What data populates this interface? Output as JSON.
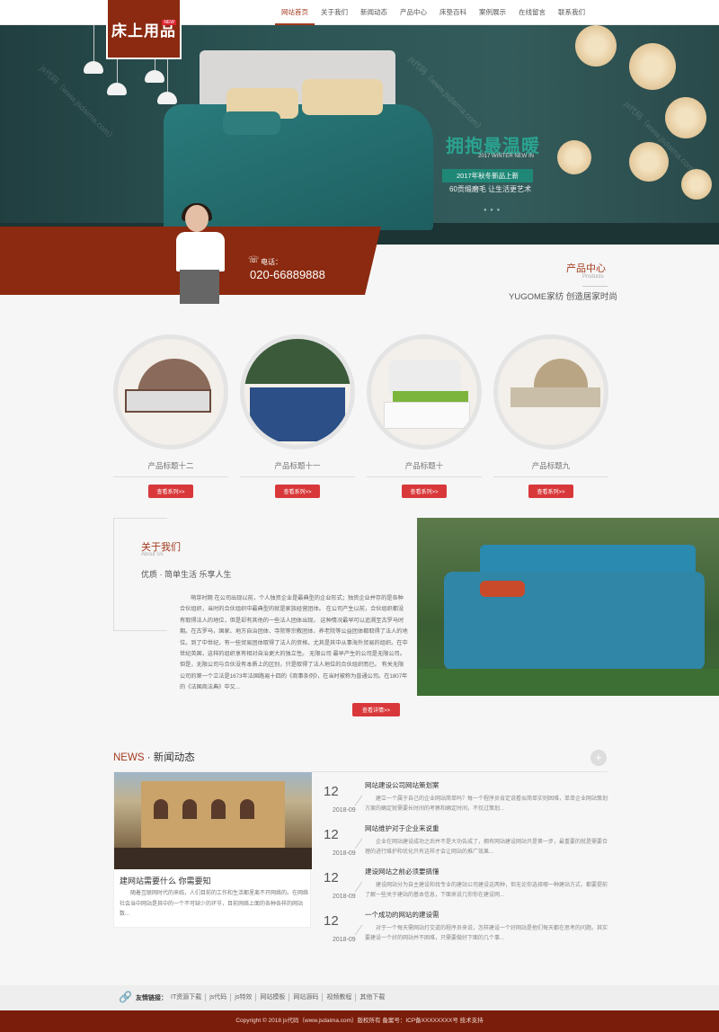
{
  "header": {
    "logo_text": "床上用品",
    "logo_badge": "NEW",
    "nav": [
      {
        "label": "网站首页",
        "active": true
      },
      {
        "label": "关于我们"
      },
      {
        "label": "新闻动态"
      },
      {
        "label": "产品中心"
      },
      {
        "label": "床垫百科"
      },
      {
        "label": "案例展示"
      },
      {
        "label": "在线留言"
      },
      {
        "label": "联系我们"
      }
    ]
  },
  "banner": {
    "headline": "拥抱最温暖",
    "subtitle_en": "2017 WINTER NEW IN",
    "tag": "2017年秋冬新品上新",
    "tagline": "60贡缎磨毛 让生活更艺术",
    "watermark": "js代码（www.jsdaima.com）"
  },
  "contact": {
    "label": "电话：",
    "phone": "020-66889888"
  },
  "products_section": {
    "title": "产品中心",
    "title_en": "Products",
    "slogan": "YUGOME家纺 创造居家时尚",
    "items": [
      {
        "name": "产品标题十二",
        "button": "查看系列>>"
      },
      {
        "name": "产品标题十一",
        "button": "查看系列>>"
      },
      {
        "name": "产品标题十",
        "button": "查看系列>>"
      },
      {
        "name": "产品标题九",
        "button": "查看系列>>"
      }
    ]
  },
  "about": {
    "title": "关于我们",
    "title_en": "About Us",
    "slogan": "优质 · 简单生活 乐享人生",
    "text": "萌芽时期 在公司出现以前，个人独资企业是最典型的企业形式；独资企业并存的是各种合伙组织，当时的合伙组织中最典型的就是家族经营团体。 在公司产生以前，合伙组织都没有取得法人的地位，但是却有其他的一些法人团体出现。 这种情况最早可以追溯至古罗马时期。在古罗马，国家、地方自治团体、寺院等宗教团体、养老院等公益团体都取得了法人的地位。到了中世纪，有一些贸易团体取得了法人的资格，尤其是其中从事海外贸易的组织。在中世纪英国，这样的组织享有相对自治更大的独立性。 无限公司 最早产生的公司是无限公司。但是，无限公司与合伙没有本质上的区别，只是取得了法人地位的合伙组织而已。 有关无限公司的第一个立法是1673年法国路易十四的《商事条例》，在当时被称为普通公司。在1807年的《法国商法典》中又...",
    "button": "查看详情>>"
  },
  "news": {
    "title_en": "NEWS",
    "title_cn": " · 新闻动态",
    "plus": "+",
    "feature": {
      "title": "建网站需要什么 你需要知",
      "desc": "随着互联网时代的来临，人们目前的工作和生活都里离不开网络的。在网络社会当中网站是其中的一个不可缺少的环节，目前网络上面的各种各样的网站数..."
    },
    "items": [
      {
        "day": "12",
        "ym": "2018-09",
        "title": "网站建设公司网站策划案",
        "desc": "建立一个属于自己的企业网站简单吗？每一个程序员肯定说看似简单实则困难，单单企业网站策划方案的确定就需要长时间的考察和确定时间，不仅过策划..."
      },
      {
        "day": "12",
        "ym": "2018-09",
        "title": "网站维护对于企业来说重",
        "desc": "企业在网站建设成功之后并不是大功告成了，拥有网站建设网站只是第一步，最重要的就是需要合理的进行维护和优化只有这样才会让网站的推广效果..."
      },
      {
        "day": "12",
        "ym": "2018-09",
        "title": "建设网站之前必须要搞懂",
        "desc": "建设网站分为自主建设和找专业的建站公司建设这两种，但无论你选择哪一种建站方式，都要提前了解一些关于建站的基本信息，下面来说几你你在建设网..."
      },
      {
        "day": "12",
        "ym": "2018-09",
        "title": "一个成功的网站的建设需",
        "desc": "对于一个每天需网站打交道的程序员来说，怎样建设一个好网站是他们每天都在思考的问题。其实要建设一个好的网站并不困难，只需要做好下面的几个事..."
      }
    ]
  },
  "links": {
    "label": "友情链接：",
    "items": [
      "IT资源下载",
      "js代码",
      "js特效",
      "网站模板",
      "网站源码",
      "视频教程",
      "其他下载"
    ]
  },
  "footer": {
    "text": "Copyright © 2018 js代码（www.jsdaima.com）版权所有 备案号：ICP备XXXXXXXX号 技术支持"
  },
  "colors": {
    "brand": "#8b2a10",
    "accent": "#a33a1e",
    "button": "#d9383a"
  }
}
